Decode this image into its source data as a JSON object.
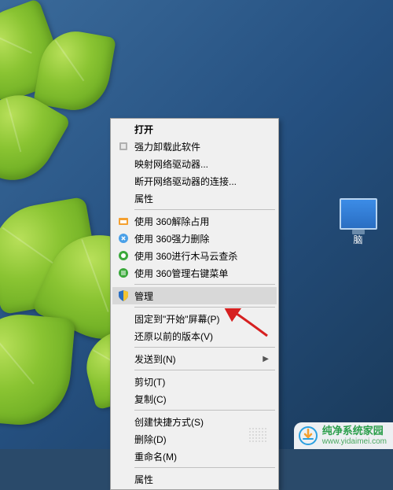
{
  "desktop": {
    "icon_label_partial": "脑"
  },
  "menu": {
    "open": "打开",
    "force_uninstall": "强力卸载此软件",
    "map_network_drive": "映射网络驱动器...",
    "disconnect_network_drive": "断开网络驱动器的连接...",
    "properties_top": "属性",
    "use_360_release": "使用 360解除占用",
    "use_360_force_delete": "使用 360强力删除",
    "use_360_trojan_scan": "使用 360进行木马云查杀",
    "use_360_manage_context": "使用 360管理右键菜单",
    "manage": "管理",
    "pin_to_start": "固定到\"开始\"屏幕(P)",
    "restore_previous": "还原以前的版本(V)",
    "send_to": "发送到(N)",
    "cut": "剪切(T)",
    "copy": "复制(C)",
    "create_shortcut": "创建快捷方式(S)",
    "delete": "删除(D)",
    "rename": "重命名(M)",
    "properties": "属性"
  },
  "watermark": {
    "title": "纯净系统家园",
    "url": "www.yidaimei.com"
  },
  "colors": {
    "menu_bg": "#f0f0f0",
    "menu_highlight": "#d8d8d8",
    "arrow_red": "#d62020",
    "shield_blue": "#2a6ec2",
    "shield_yellow": "#f4c430",
    "leaf_green": "#8ac432",
    "brand_green": "#2a9e4a"
  }
}
